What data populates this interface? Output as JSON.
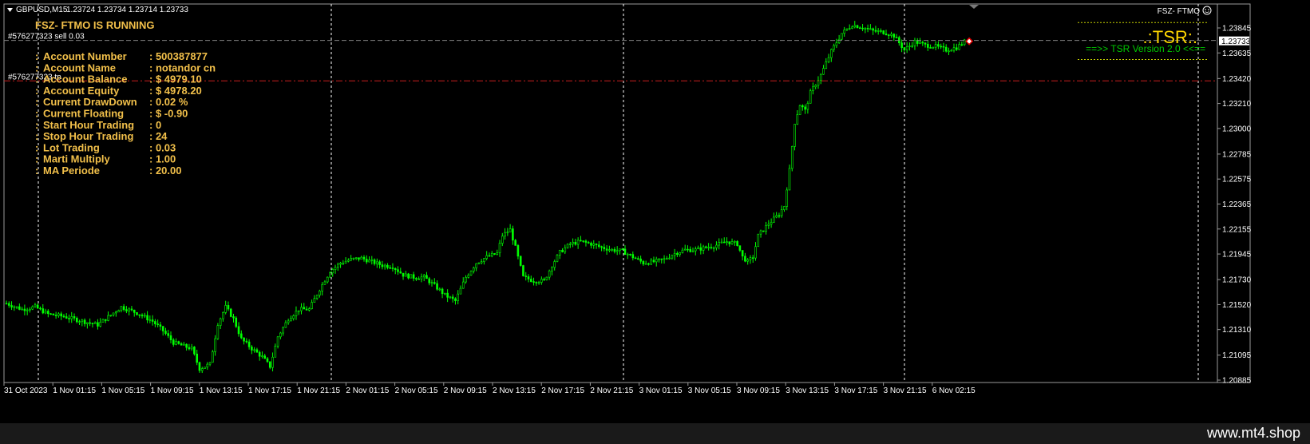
{
  "header": {
    "symbol": "GBPUSD,M15",
    "ohlc": "1.23724 1.23734 1.23714 1.23733",
    "ea_label": "FSZ- FTMO"
  },
  "panel": {
    "status": "FSZ- FTMO IS RUNNING",
    "rows": [
      {
        "label": "Account Number",
        "value": ": 500387877"
      },
      {
        "label": "Account Name",
        "value": ": notandor cn"
      },
      {
        "label": "Account Balance",
        "value": ": $ 4979.10"
      },
      {
        "label": "Account Equity",
        "value": ": $ 4978.20"
      },
      {
        "label": "Current DrawDown",
        "value": ": 0.02 %"
      },
      {
        "label": "Current Floating",
        "value": ": $ -0.90"
      },
      {
        "label": "Start Hour Trading",
        "value": ": 0"
      },
      {
        "label": "Stop Hour Trading",
        "value": ": 24"
      },
      {
        "label": "Lot Trading",
        "value": ": 0.03"
      },
      {
        "label": "Marti Multiply",
        "value": ": 1.00"
      },
      {
        "label": "MA Periode",
        "value": ": 20.00"
      }
    ]
  },
  "tsr": {
    "title": ".:TSR:.",
    "version": "==>>  TSR Version 2.0  <<=="
  },
  "orders": {
    "sell_label": "#576277323 sell 0.03",
    "tp_label": "#576277323 tp"
  },
  "watermark": "www.mt4.shop",
  "colors": {
    "background": "#000000",
    "candle": "#00ff00",
    "panel_text": "#f2c04a",
    "tsr_text": "#ffd700",
    "version_text": "#00c800",
    "tp_line": "#c81e1e",
    "order_line": "#808080",
    "grid": "#ffffff"
  },
  "chart_data": {
    "type": "candlestick",
    "y_ticks": [
      "1.23845",
      "1.23635",
      "1.23420",
      "1.23210",
      "1.23000",
      "1.22785",
      "1.22575",
      "1.22365",
      "1.22155",
      "1.21945",
      "1.21730",
      "1.21520",
      "1.21310",
      "1.21095",
      "1.20885"
    ],
    "ylim": [
      1.20885,
      1.23845
    ],
    "x_ticks": [
      "31 Oct 2023",
      "1 Nov 01:15",
      "1 Nov 05:15",
      "1 Nov 09:15",
      "1 Nov 13:15",
      "1 Nov 17:15",
      "1 Nov 21:15",
      "2 Nov 01:15",
      "2 Nov 05:15",
      "2 Nov 09:15",
      "2 Nov 13:15",
      "2 Nov 17:15",
      "2 Nov 21:15",
      "3 Nov 01:15",
      "3 Nov 05:15",
      "3 Nov 09:15",
      "3 Nov 13:15",
      "3 Nov 17:15",
      "3 Nov 21:15",
      "6 Nov 02:15"
    ],
    "current_price": "1.23733",
    "tp_price": 1.234,
    "sell_price": 1.2374,
    "tsr_band_upper": 1.2389,
    "tsr_band_lower": 1.2358,
    "anchors": [
      [
        0,
        1.2153
      ],
      [
        6,
        1.2148
      ],
      [
        11,
        1.215
      ],
      [
        16,
        1.2144
      ],
      [
        22,
        1.2142
      ],
      [
        31,
        1.2137
      ],
      [
        35,
        1.2135
      ],
      [
        44,
        1.215
      ],
      [
        50,
        1.2145
      ],
      [
        56,
        1.2138
      ],
      [
        60,
        1.213
      ],
      [
        64,
        1.212
      ],
      [
        68,
        1.2117
      ],
      [
        71,
        1.2115
      ],
      [
        74,
        1.2098
      ],
      [
        78,
        1.2102
      ],
      [
        81,
        1.2136
      ],
      [
        84,
        1.215
      ],
      [
        87,
        1.214
      ],
      [
        90,
        1.2123
      ],
      [
        94,
        1.2115
      ],
      [
        98,
        1.2108
      ],
      [
        101,
        1.21
      ],
      [
        104,
        1.2125
      ],
      [
        108,
        1.214
      ],
      [
        112,
        1.2148
      ],
      [
        116,
        1.2148
      ],
      [
        120,
        1.2165
      ],
      [
        124,
        1.218
      ],
      [
        128,
        1.2187
      ],
      [
        132,
        1.219
      ],
      [
        136,
        1.2191
      ],
      [
        140,
        1.2188
      ],
      [
        144,
        1.2185
      ],
      [
        148,
        1.2184
      ],
      [
        152,
        1.2177
      ],
      [
        156,
        1.2175
      ],
      [
        160,
        1.2175
      ],
      [
        164,
        1.2168
      ],
      [
        168,
        1.216
      ],
      [
        172,
        1.2155
      ],
      [
        176,
        1.2175
      ],
      [
        180,
        1.2187
      ],
      [
        184,
        1.2192
      ],
      [
        188,
        1.2195
      ],
      [
        190,
        1.221
      ],
      [
        193,
        1.2215
      ],
      [
        195,
        1.22
      ],
      [
        198,
        1.2175
      ],
      [
        202,
        1.2172
      ],
      [
        206,
        1.2172
      ],
      [
        209,
        1.2185
      ],
      [
        212,
        1.2196
      ],
      [
        216,
        1.2203
      ],
      [
        220,
        1.2205
      ],
      [
        224,
        1.2203
      ],
      [
        228,
        1.22
      ],
      [
        232,
        1.2198
      ],
      [
        236,
        1.2197
      ],
      [
        240,
        1.2192
      ],
      [
        244,
        1.2187
      ],
      [
        248,
        1.2188
      ],
      [
        252,
        1.219
      ],
      [
        256,
        1.2195
      ],
      [
        260,
        1.2198
      ],
      [
        264,
        1.2198
      ],
      [
        268,
        1.22
      ],
      [
        272,
        1.2202
      ],
      [
        276,
        1.2205
      ],
      [
        280,
        1.2203
      ],
      [
        282,
        1.2192
      ],
      [
        284,
        1.2188
      ],
      [
        286,
        1.2192
      ],
      [
        288,
        1.221
      ],
      [
        292,
        1.222
      ],
      [
        296,
        1.2228
      ],
      [
        298,
        1.2235
      ],
      [
        300,
        1.2265
      ],
      [
        302,
        1.2305
      ],
      [
        304,
        1.232
      ],
      [
        306,
        1.2315
      ],
      [
        308,
        1.233
      ],
      [
        312,
        1.2345
      ],
      [
        316,
        1.2365
      ],
      [
        320,
        1.238
      ],
      [
        324,
        1.2387
      ],
      [
        328,
        1.2385
      ],
      [
        332,
        1.2382
      ],
      [
        336,
        1.2381
      ],
      [
        340,
        1.2378
      ],
      [
        344,
        1.2366
      ],
      [
        348,
        1.2373
      ],
      [
        352,
        1.237
      ],
      [
        356,
        1.2369
      ],
      [
        360,
        1.2366
      ],
      [
        364,
        1.2368
      ],
      [
        367,
        1.2373
      ]
    ]
  }
}
